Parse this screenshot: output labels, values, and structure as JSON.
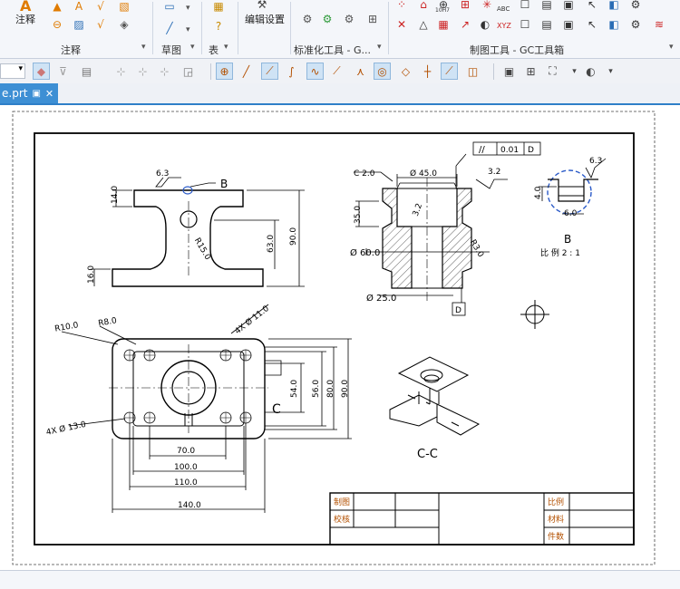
{
  "ribbon": {
    "annotation_big_label": "注释",
    "groups": [
      {
        "title": "注释"
      },
      {
        "title": "草图"
      },
      {
        "title": "表"
      },
      {
        "title": "标准化工具 - G..."
      },
      {
        "title": "制图工具 - GC工具箱"
      }
    ],
    "edit_settings_label": "编辑设置",
    "xyz_label": "XYZ",
    "abc_label": "ABC",
    "icon_num_label": "10H7"
  },
  "tab": {
    "label": "e.prt",
    "close": "✕"
  },
  "drawing": {
    "front_view": {
      "dims": [
        "6.3",
        "14.0",
        "B",
        "R15.0",
        "63.0",
        "90.0",
        "16.0"
      ]
    },
    "section_view": {
      "dims": [
        "0.01",
        "D",
        "C 2.0",
        "Ø 45.0",
        "3.2",
        "35.0",
        "3.2",
        "R3.0",
        "Ø 60.0",
        "Ø 25.0",
        "D"
      ]
    },
    "detail_view": {
      "dims": [
        "6.3",
        "4.0",
        "6.0",
        "B",
        "比 例  2 : 1"
      ]
    },
    "top_view": {
      "dims": [
        "R10.0",
        "R8.0",
        "4X Ø 11.0",
        "54.0",
        "56.0",
        "80.0",
        "90.0",
        "C",
        "4X Ø 13.0",
        "70.0",
        "100.0",
        "110.0",
        "140.0"
      ]
    },
    "iso_view": {
      "label": "C-C"
    },
    "title_block": {
      "drawn_label": "制图",
      "checked_label": "校核",
      "scale_label": "比例",
      "material_label": "材料",
      "qty_label": "件数"
    }
  },
  "colors": {
    "accent": "#3d8fd4",
    "ribbon_bg": "#f4f6fa",
    "active_btn": "#cfe3f5"
  }
}
